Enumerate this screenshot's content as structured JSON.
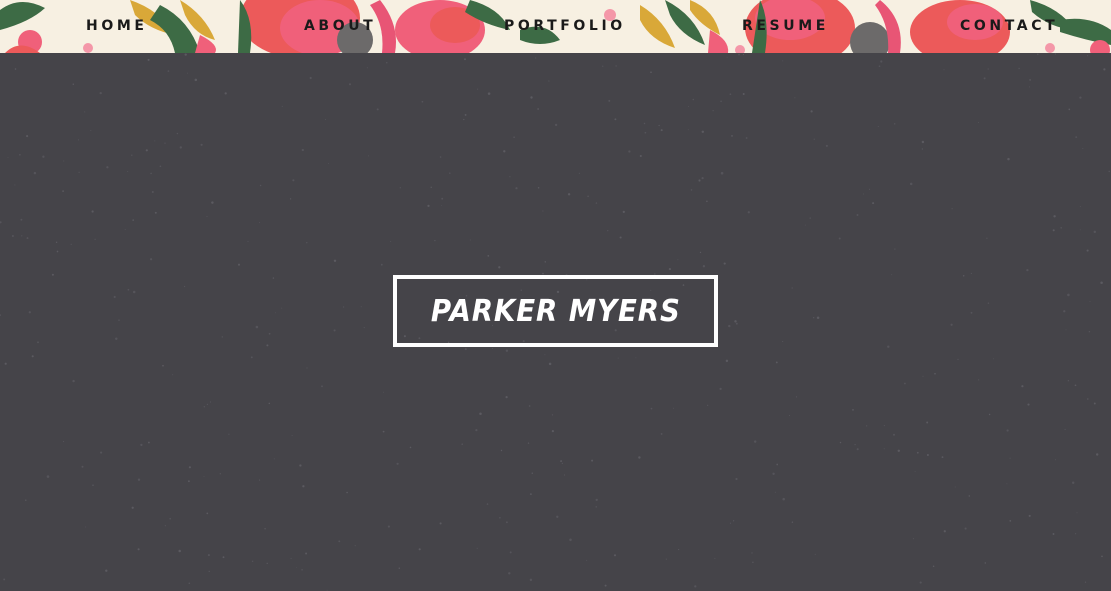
{
  "nav": {
    "items": [
      {
        "label": "HOME"
      },
      {
        "label": "ABOUT"
      },
      {
        "label": "PORTFOLIO"
      },
      {
        "label": "RESUME"
      },
      {
        "label": "CONTACT"
      }
    ]
  },
  "hero": {
    "title": "PARKER MYERS"
  },
  "colors": {
    "background": "#454449",
    "header_base": "#f6efe0",
    "title_border": "#ffffff",
    "flower_pink": "#f0607a",
    "flower_red": "#ec5a5a",
    "leaf_green": "#3d6b45",
    "leaf_gold": "#d9a838"
  }
}
